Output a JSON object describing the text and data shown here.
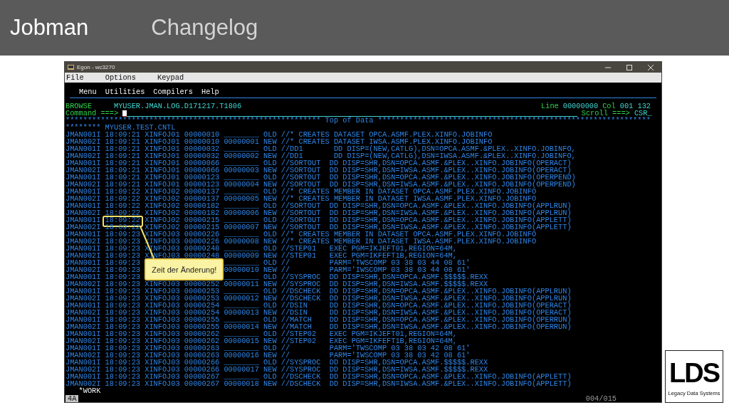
{
  "slide": {
    "title": "Jobman",
    "subtitle": "Changelog"
  },
  "window": {
    "title": "Egon - wc3270"
  },
  "menu": [
    "File",
    "Options",
    "Keypad"
  ],
  "action_bar": [
    "Menu",
    "Utilities",
    "Compilers",
    "Help"
  ],
  "browse": {
    "mode": "BROWSE",
    "dataset": "MYUSER.JMAN.LOG.D171217.T1806",
    "line_label": "Line",
    "line_value": "00000000",
    "col_label": "Col",
    "col_value": "001 132"
  },
  "command": {
    "label": "Command ===>",
    "scroll_label": "Scroll ===>",
    "scroll_value": "CSR_"
  },
  "top_of_data": {
    "left": "**********************************************************",
    "label": "Top of Data",
    "right": "**************************************************************"
  },
  "dataset_header": "******** MYUSER.TEST.CNTL",
  "rows": [
    {
      "msg": "JMAN001I",
      "time": "18:09:21",
      "job": "XINFOJ01",
      "line": "00000010",
      "ref": "________",
      "status": "OLD",
      "text": "//* CREATES DATASET OPCA.ASMF.PLEX.XINFO.JOBINFO",
      "highlighted": false
    },
    {
      "msg": "JMAN002I",
      "time": "18:09:21",
      "job": "XINFOJ01",
      "line": "00000010",
      "ref": "00000001",
      "status": "NEW",
      "text": "//* CREATES DATASET IWSA.ASMF.PLEX.XINFO.JOBINFO",
      "highlighted": false
    },
    {
      "msg": "JMAN001I",
      "time": "18:09:21",
      "job": "XINFOJ01",
      "line": "00000032",
      "ref": "________",
      "status": "OLD",
      "text": "//DD1       DD DISP=(NEW,CATLG),DSN=OPCA.ASMF.&PLEX..XINFO.JOBINFO,",
      "highlighted": false
    },
    {
      "msg": "JMAN002I",
      "time": "18:09:21",
      "job": "XINFOJ01",
      "line": "00000032",
      "ref": "00000002",
      "status": "NEW",
      "text": "//DD1       DD DISP=(NEW,CATLG),DSN=IWSA.ASMF.&PLEX..XINFO.JOBINFO,",
      "highlighted": false
    },
    {
      "msg": "JMAN001I",
      "time": "18:09:21",
      "job": "XINFOJ01",
      "line": "00000066",
      "ref": "________",
      "status": "OLD",
      "text": "//SORTOUT  DD DISP=SHR,DSN=OPCA.ASMF.&PLEX..XINFO.JOBINFO(OPERACT)",
      "highlighted": false
    },
    {
      "msg": "JMAN002I",
      "time": "18:09:21",
      "job": "XINFOJ01",
      "line": "00000066",
      "ref": "00000003",
      "status": "NEW",
      "text": "//SORTOUT  DD DISP=SHR,DSN=IWSA.ASMF.&PLEX..XINFO.JOBINFO(OPERACT)",
      "highlighted": false
    },
    {
      "msg": "JMAN001I",
      "time": "18:09:21",
      "job": "XINFOJ01",
      "line": "00000123",
      "ref": "________",
      "status": "OLD",
      "text": "//SORTOUT  DD DISP=SHR,DSN=OPCA.ASMF.&PLEX..XINFO.JOBINFO(OPERPEND)",
      "highlighted": false
    },
    {
      "msg": "JMAN002I",
      "time": "18:09:21",
      "job": "XINFOJ01",
      "line": "00000123",
      "ref": "00000004",
      "status": "NEW",
      "text": "//SORTOUT  DD DISP=SHR,DSN=IWSA.ASMF.&PLEX..XINFO.JOBINFO(OPERPEND)",
      "highlighted": false
    },
    {
      "msg": "JMAN001I",
      "time": "18:09:22",
      "job": "XINFOJ02",
      "line": "00000137",
      "ref": "________",
      "status": "OLD",
      "text": "//* CREATES MEMBER IN DATASET OPCA.ASMF.PLEX.XINFO.JOBINFO",
      "highlighted": false
    },
    {
      "msg": "JMAN002I",
      "time": "18:09:22",
      "job": "XINFOJ02",
      "line": "00000137",
      "ref": "00000005",
      "status": "NEW",
      "text": "//* CREATES MEMBER IN DATASET IWSA.ASMF.PLEX.XINFO.JOBINFO",
      "highlighted": false
    },
    {
      "msg": "JMAN001I",
      "time": "18:09:22",
      "job": "XINFOJ02",
      "line": "00000182",
      "ref": "________",
      "status": "OLD",
      "text": "//SORTOUT  DD DISP=SHR,DSN=OPCA.ASMF.&PLEX..XINFO.JOBINFO(APPLRUN)",
      "highlighted": false
    },
    {
      "msg": "JMAN002I",
      "time": "18:09:22",
      "job": "XINFOJ02",
      "line": "00000182",
      "ref": "00000006",
      "status": "NEW",
      "text": "//SORTOUT  DD DISP=SHR,DSN=IWSA.ASMF.&PLEX..XINFO.JOBINFO(APPLRUN)",
      "highlighted": false
    },
    {
      "msg": "JMAN001I",
      "time": "18:09:22",
      "job": "XINFOJ02",
      "line": "00000215",
      "ref": "________",
      "status": "OLD",
      "text": "//SORTOUT  DD DISP=SHR,DSN=OPCA.ASMF.&PLEX..XINFO.JOBINFO(APPLETT)",
      "highlighted": true
    },
    {
      "msg": "JMAN002I",
      "time": "18:09:22",
      "job": "XINFOJ02",
      "line": "00000215",
      "ref": "00000007",
      "status": "NEW",
      "text": "//SORTOUT  DD DISP=SHR,DSN=IWSA.ASMF.&PLEX..XINFO.JOBINFO(APPLETT)",
      "highlighted": false
    },
    {
      "msg": "JMAN001I",
      "time": "18:09:23",
      "job": "XINFOJ03",
      "line": "00000226",
      "ref": "________",
      "status": "OLD",
      "text": "//* CREATES MEMBER IN DATASET OPCA.ASMF.PLEX.XINFO.JOBINFO",
      "highlighted": false
    },
    {
      "msg": "JMAN002I",
      "time": "18:09:23",
      "job": "XINFOJ03",
      "line": "00000226",
      "ref": "00000008",
      "status": "NEW",
      "text": "//* CREATES MEMBER IN DATASET IWSA.ASMF.PLEX.XINFO.JOBINFO",
      "highlighted": false
    },
    {
      "msg": "JMAN001I",
      "time": "18:09:23",
      "job": "XINFOJ03",
      "line": "00000248",
      "ref": "________",
      "status": "OLD",
      "text": "//STEP01   EXEC PGM=IKJEFT01,REGION=64M,",
      "highlighted": false
    },
    {
      "msg": "JMAN002I",
      "time": "18:09:23",
      "job": "XINFOJ03",
      "line": "00000248",
      "ref": "00000009",
      "status": "NEW",
      "text": "//STEP01   EXEC PGM=IKFEFT1B,REGION=64M,",
      "highlighted": false
    },
    {
      "msg": "JMAN001I",
      "time": "18:09:23",
      "ref": "________",
      "status": "OLD",
      "text": "//         PARM='TWSCOMP 03 38 03 44 08 61'",
      "highlighted": false
    },
    {
      "msg": "JMAN002I",
      "time": "18:09:23",
      "ref": "00000010",
      "status": "NEW",
      "text": "//         PARM='IWSCOMP 03 38 03 44 08 61'",
      "highlighted": false
    },
    {
      "msg": "JMAN001I",
      "time": "18:09:23",
      "ref": "________",
      "status": "OLD",
      "text": "//SYSPROC  DD DISP=SHR,DSN=OPCA.ASMF.$$$$$.REXX",
      "highlighted": false
    },
    {
      "msg": "JMAN002I",
      "time": "18:09:23",
      "job": "XINFOJ03",
      "line": "00000252",
      "ref": "00000011",
      "status": "NEW",
      "text": "//SYSPROC  DD DISP=SHR,DSN=IWSA.ASMF.$$$$$.REXX",
      "highlighted": false
    },
    {
      "msg": "JMAN001I",
      "time": "18:09:23",
      "job": "XINFOJ03",
      "line": "00000253",
      "ref": "________",
      "status": "OLD",
      "text": "//DSCHECK  DD DISP=SHR,DSN=OPCA.ASMF.&PLEX..XINFO.JOBINFO(APPLRUN)",
      "highlighted": false
    },
    {
      "msg": "JMAN002I",
      "time": "18:09:23",
      "job": "XINFOJ03",
      "line": "00000253",
      "ref": "00000012",
      "status": "NEW",
      "text": "//DSCHECK  DD DISP=SHR,DSN=IWSA.ASMF.&PLEX..XINFO.JOBINFO(APPLRUN)",
      "highlighted": false
    },
    {
      "msg": "JMAN001I",
      "time": "18:09:23",
      "job": "XINFOJ03",
      "line": "00000254",
      "ref": "________",
      "status": "OLD",
      "text": "//DSIN     DD DISP=SHR,DSN=OPCA.ASMF.&PLEX..XINFO.JOBINFO(OPERACT)",
      "highlighted": false
    },
    {
      "msg": "JMAN002I",
      "time": "18:09:23",
      "job": "XINFOJ03",
      "line": "00000254",
      "ref": "00000013",
      "status": "NEW",
      "text": "//DSIN     DD DISP=SHR,DSN=IWSA.ASMF.&PLEX..XINFO.JOBINFO(OPERACT)",
      "highlighted": false
    },
    {
      "msg": "JMAN001I",
      "time": "18:09:23",
      "job": "XINFOJ03",
      "line": "00000255",
      "ref": "________",
      "status": "OLD",
      "text": "//MATCH    DD DISP=SHR,DSN=OPCA.ASMF.&PLEX..XINFO.JOBINFO(OPERRUN)",
      "highlighted": false
    },
    {
      "msg": "JMAN002I",
      "time": "18:09:23",
      "job": "XINFOJ03",
      "line": "00000255",
      "ref": "00000014",
      "status": "NEW",
      "text": "//MATCH    DD DISP=SHR,DSN=IWSA.ASMF.&PLEX..XINFO.JOBINFO(OPERRUN)",
      "highlighted": false
    },
    {
      "msg": "JMAN001I",
      "time": "18:09:23",
      "job": "XINFOJ03",
      "line": "00000262",
      "ref": "________",
      "status": "OLD",
      "text": "//STEP02   EXEC PGM=IKJEFT01,REGION=64M,",
      "highlighted": false
    },
    {
      "msg": "JMAN002I",
      "time": "18:09:23",
      "job": "XINFOJ03",
      "line": "00000262",
      "ref": "00000015",
      "status": "NEW",
      "text": "//STEP02   EXEC PGM=IKFEFT1B,REGION=64M,",
      "highlighted": false
    },
    {
      "msg": "JMAN001I",
      "time": "18:09:23",
      "job": "XINFOJ03",
      "line": "00000263",
      "ref": "________",
      "status": "OLD",
      "text": "//         PARM='TWSCOMP 03 38 03 42 08 61'",
      "highlighted": false
    },
    {
      "msg": "JMAN002I",
      "time": "18:09:23",
      "job": "XINFOJ03",
      "line": "00000263",
      "ref": "00000016",
      "status": "NEW",
      "text": "//         PARM='IWSCOMP 03 38 03 42 08 61'",
      "highlighted": false
    },
    {
      "msg": "JMAN001I",
      "time": "18:09:23",
      "job": "XINFOJ03",
      "line": "00000266",
      "ref": "________",
      "status": "OLD",
      "text": "//SYSPROC  DD DISP=SHR,DSN=OPCA.ASMF.$$$$$.REXX",
      "highlighted": false
    },
    {
      "msg": "JMAN002I",
      "time": "18:09:23",
      "job": "XINFOJ03",
      "line": "00000266",
      "ref": "00000017",
      "status": "NEW",
      "text": "//SYSPROC  DD DISP=SHR,DSN=IWSA.ASMF.$$$$$.REXX",
      "highlighted": false
    },
    {
      "msg": "JMAN001I",
      "time": "18:09:23",
      "job": "XINFOJ03",
      "line": "00000267",
      "ref": "________",
      "status": "OLD",
      "text": "//DSCHECK  DD DISP=SHR,DSN=OPCA.ASMF.&PLEX..XINFO.JOBINFO(APPLETT)",
      "highlighted": false
    },
    {
      "msg": "JMAN002I",
      "time": "18:09:23",
      "job": "XINFOJ03",
      "line": "00000267",
      "ref": "00000018",
      "status": "NEW",
      "text": "//DSCHECK  DD DISP=SHR,DSN=IWSA.ASMF.&PLEX..XINFO.JOBINFO(APPLETT)",
      "highlighted": false
    }
  ],
  "callout": {
    "text": "Zeit der Änderung!"
  },
  "footer": {
    "label": "*WORK",
    "screen": "4A",
    "page": "004/015"
  },
  "logo": {
    "mark": "LDS",
    "name": "Legacy Data Systems"
  }
}
